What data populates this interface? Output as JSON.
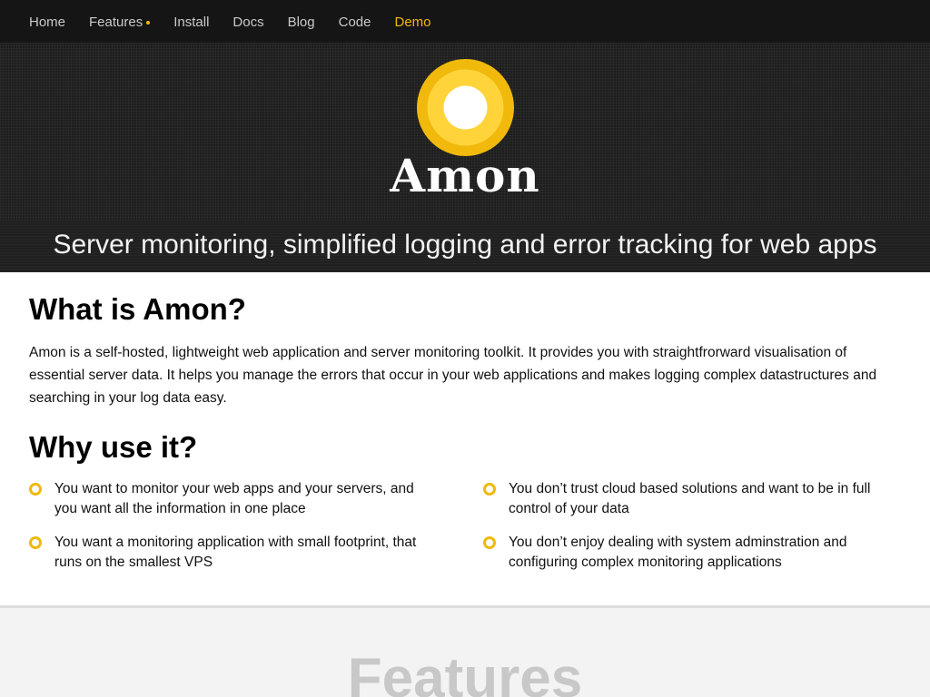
{
  "nav": {
    "items": [
      {
        "label": "Home"
      },
      {
        "label": "Features"
      },
      {
        "label": "Install"
      },
      {
        "label": "Docs"
      },
      {
        "label": "Blog"
      },
      {
        "label": "Code"
      },
      {
        "label": "Demo"
      }
    ]
  },
  "hero": {
    "brand": "Amon",
    "tagline": "Server monitoring, simplified logging and error tracking for web apps",
    "logo_icon": "amon-logo-icon",
    "colors": {
      "accent": "#f0b90b",
      "accent_light": "#ffd43b"
    }
  },
  "what": {
    "title": "What is Amon?",
    "text": "Amon is a self-hosted, lightweight web application and server monitoring toolkit. It provides you with straightfrorward visualisation of essential server data. It helps you manage the errors that occur in your web applications and makes logging complex datastructures and searching in your log data easy."
  },
  "why": {
    "title": "Why use it?",
    "reasons": [
      {
        "text": "You want to monitor your web apps and your servers, and you want all the information in one place"
      },
      {
        "text": "You don’t trust cloud based solutions and want to be in full control of your data"
      },
      {
        "text": "You want a monitoring application with small footprint, that runs on the smallest VPS"
      },
      {
        "text": "You don’t enjoy dealing with system adminstration and configuring complex monitoring applications"
      }
    ]
  },
  "features": {
    "title": "Features"
  }
}
